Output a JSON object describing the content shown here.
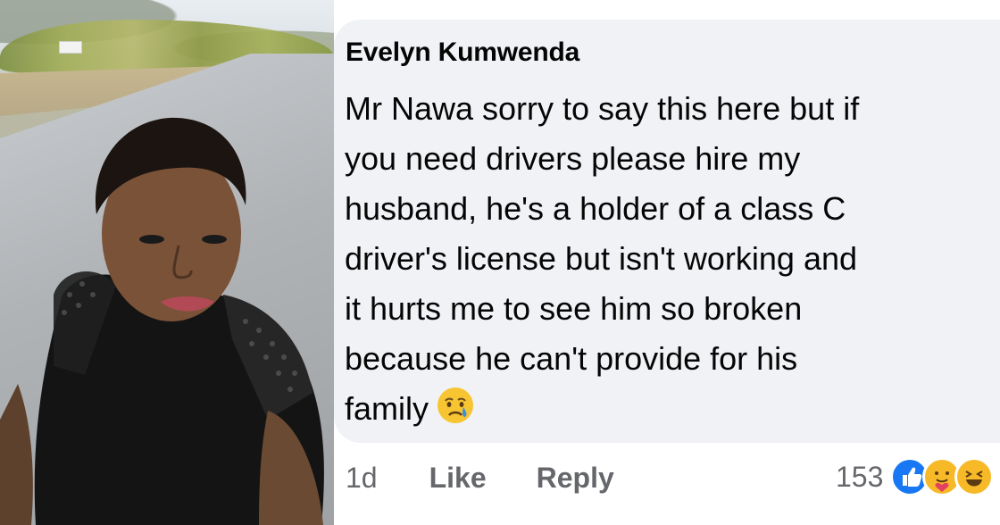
{
  "comment": {
    "author": "Evelyn Kumwenda",
    "lines": [
      "Mr Nawa sorry to say this here but if",
      "you need drivers please hire my",
      "husband, he's a holder of a class C",
      "driver's license but isn't working and",
      "it hurts me to see him so broken",
      "because he can't provide for his",
      "family"
    ],
    "emoji": "crying-face-emoji"
  },
  "actions": {
    "time": "1d",
    "like_label": "Like",
    "reply_label": "Reply"
  },
  "reactions": {
    "count": "153",
    "icons": [
      "like-icon",
      "care-icon",
      "haha-icon"
    ]
  },
  "colors": {
    "bubble_bg": "#f0f2f5",
    "text": "#050505",
    "secondary_text": "#65676b",
    "like_blue": "#1877f2",
    "reaction_yellow": "#f7b928"
  }
}
